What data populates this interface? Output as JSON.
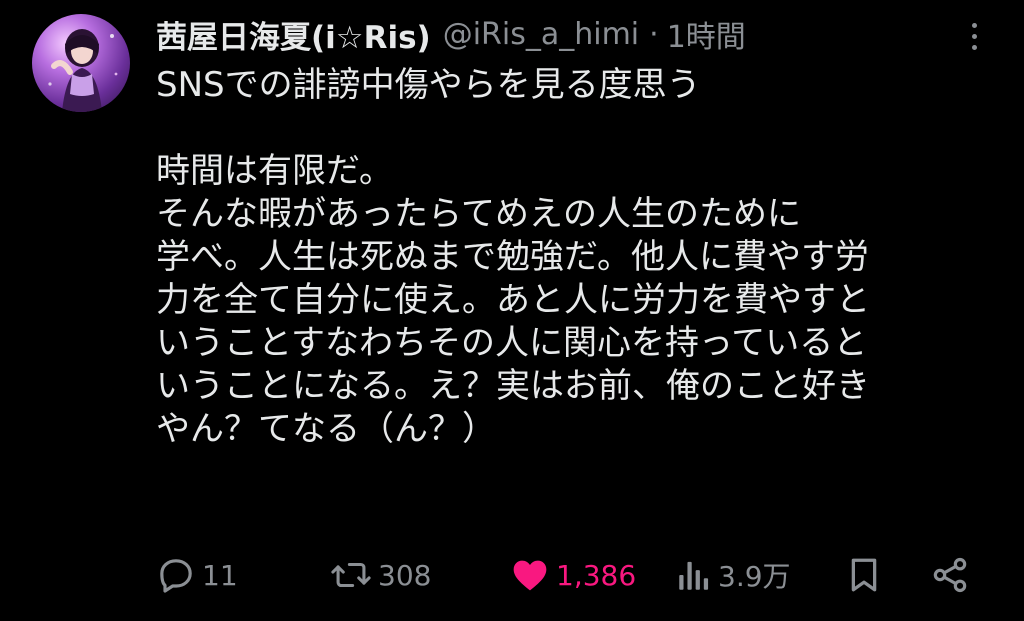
{
  "author": {
    "display_name": "茜屋日海夏(i☆Ris)",
    "handle": "@iRis_a_himi",
    "separator": "·",
    "time": "1時間"
  },
  "tweet": {
    "lines": [
      "SNSでの誹謗中傷やらを見る度思う",
      "",
      "時間は有限だ。",
      "そんな暇があったらてめえの人生のために",
      "学べ。人生は死ぬまで勉強だ。他人に費やす労",
      "力を全て自分に使え。あと人に労力を費やすと",
      "いうことすなわちその人に関心を持っていると",
      "いうことになる。え？実はお前、俺のこと好き",
      "やん？てなる（ん？）"
    ]
  },
  "actions": {
    "reply": {
      "icon": "reply-icon",
      "count": "11"
    },
    "retweet": {
      "icon": "retweet-icon",
      "count": "308"
    },
    "like": {
      "icon": "heart-icon",
      "count": "1,386",
      "color": "#f91880",
      "liked": true
    },
    "views": {
      "icon": "views-icon",
      "count": "3.9万"
    },
    "bookmark": {
      "icon": "bookmark-icon"
    },
    "share": {
      "icon": "share-icon"
    }
  },
  "colors": {
    "background": "#000000",
    "text": "#e7e9ea",
    "secondary": "#8b8f94",
    "like": "#f91880"
  }
}
